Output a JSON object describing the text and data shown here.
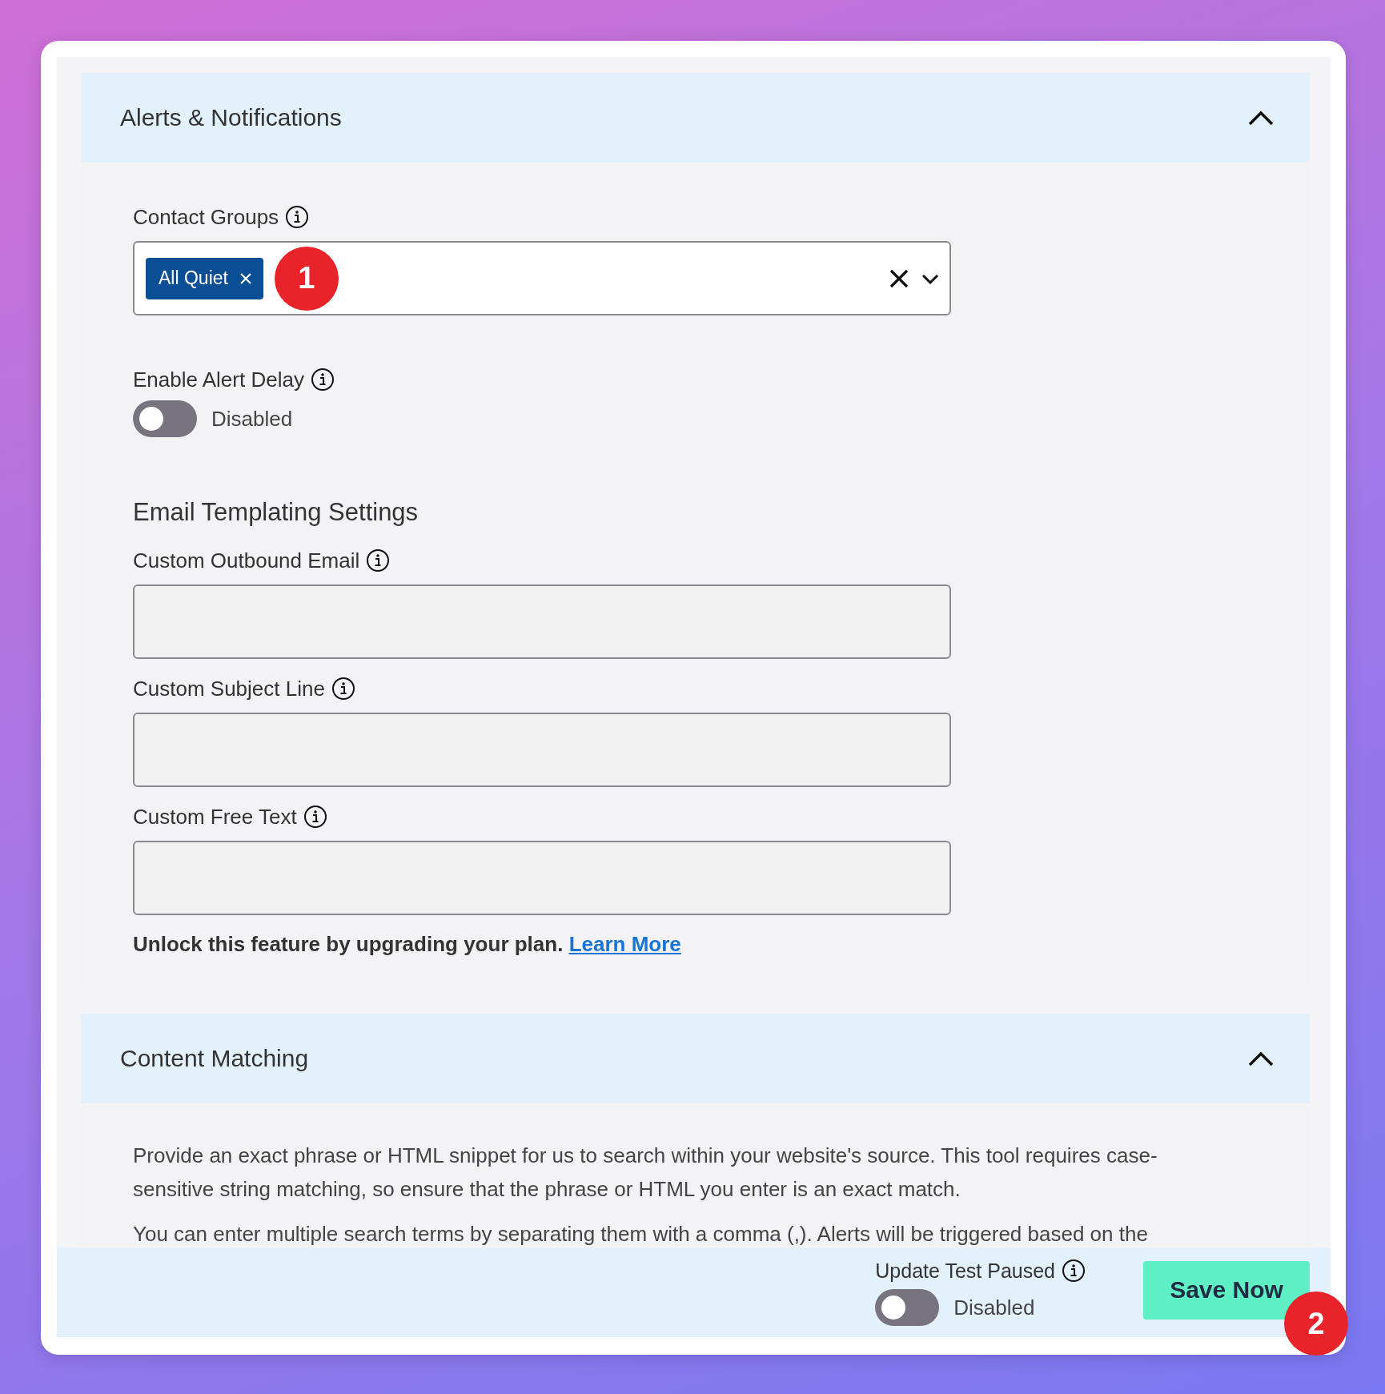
{
  "sections": [
    {
      "title": "Alerts & Notifications",
      "expanded": true,
      "fields": [
        {
          "kind": "multiselect",
          "label": "Contact Groups",
          "tags": [
            "All Quiet"
          ],
          "callout": "1"
        },
        {
          "kind": "toggle",
          "label": "Enable Alert Delay",
          "on": false,
          "state_label": "Disabled"
        },
        {
          "kind": "heading",
          "text": "Email Templating Settings"
        },
        {
          "kind": "text",
          "label": "Custom Outbound Email"
        },
        {
          "kind": "text",
          "label": "Custom Subject Line"
        },
        {
          "kind": "text",
          "label": "Custom Free Text"
        },
        {
          "kind": "note",
          "text": "Unlock this feature by upgrading your plan.",
          "link": "Learn More"
        }
      ]
    },
    {
      "title": "Content Matching",
      "expanded": true,
      "fields": [
        {
          "kind": "paragraph",
          "text": "Provide an exact phrase or HTML snippet for us to search within your website's source. This tool requires case-sensitive string matching, so ensure that the phrase or HTML you enter is an exact match."
        },
        {
          "kind": "paragraph",
          "text": "You can enter multiple search terms by separating them with a comma (,). Alerts will be triggered based on the"
        }
      ]
    }
  ],
  "footer": {
    "toggle": {
      "label": "Update Test Paused",
      "on": false,
      "state_label": "Disabled"
    },
    "button": "Save Now",
    "callout": "2"
  }
}
